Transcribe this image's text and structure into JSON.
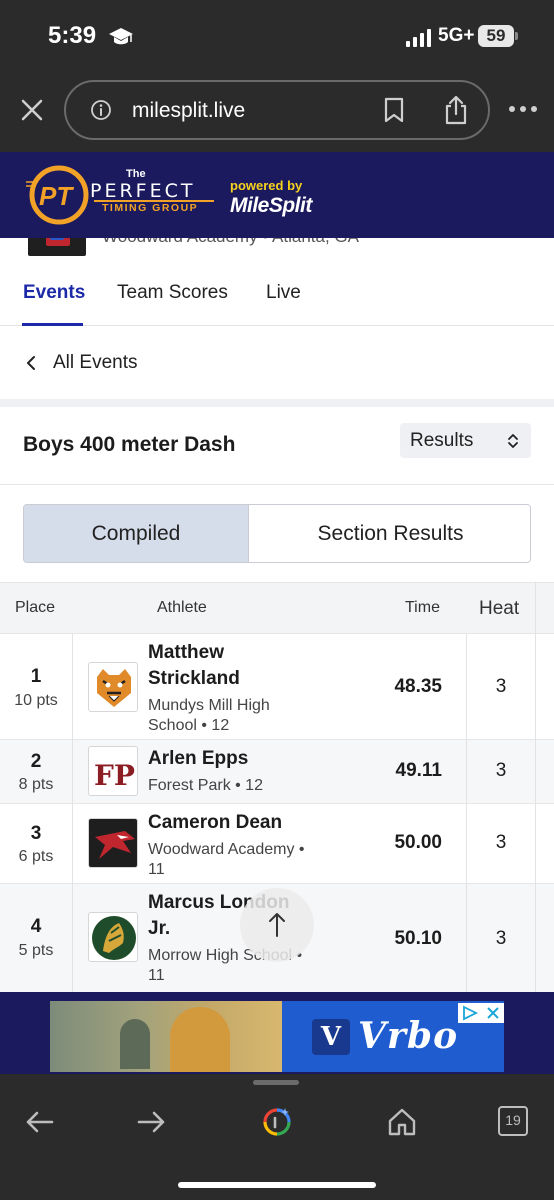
{
  "status_bar": {
    "time": "5:39",
    "network": "5G+",
    "battery": "59"
  },
  "browser": {
    "url": "milesplit.live",
    "tab_count": "19"
  },
  "banner": {
    "brand_the": "The",
    "brand_name": "PERFECT",
    "brand_sub": "TIMING GROUP",
    "powered_by": "powered by",
    "partner": "MileSplit"
  },
  "meet": {
    "location": "Woodward Academy • Atlanta, GA"
  },
  "tabs": [
    {
      "label": "Events",
      "active": true
    },
    {
      "label": "Team Scores",
      "active": false
    },
    {
      "label": "Live",
      "active": false
    }
  ],
  "back_link": "All Events",
  "event": {
    "title": "Boys 400 meter Dash",
    "view_select": "Results"
  },
  "segments": {
    "compiled": "Compiled",
    "section": "Section Results"
  },
  "table": {
    "headers": {
      "place": "Place",
      "athlete": "Athlete",
      "time": "Time",
      "heat": "Heat"
    },
    "rows": [
      {
        "place": "1",
        "points": "10 pts",
        "name": "Matthew Strickland",
        "school": "Mundys Mill High School • 12",
        "time": "48.35",
        "heat": "3",
        "logo": "tiger-logo-icon"
      },
      {
        "place": "2",
        "points": "8 pts",
        "name": "Arlen Epps",
        "school": "Forest Park • 12",
        "time": "49.11",
        "heat": "3",
        "logo": "fp-logo-icon"
      },
      {
        "place": "3",
        "points": "6 pts",
        "name": "Cameron Dean",
        "school": "Woodward Academy • 11",
        "time": "50.00",
        "heat": "3",
        "logo": "eagle-logo-icon"
      },
      {
        "place": "4",
        "points": "5 pts",
        "name": "Marcus London Jr.",
        "school": "Morrow High School • 11",
        "time": "50.10",
        "heat": "3",
        "logo": "mustang-logo-icon"
      }
    ]
  },
  "ad": {
    "brand": "Vrbo",
    "monogram": "V"
  },
  "colors": {
    "banner_bg": "#1b1a5f",
    "accent": "#1d2aa8",
    "browser_chrome": "#2b2b2b"
  }
}
